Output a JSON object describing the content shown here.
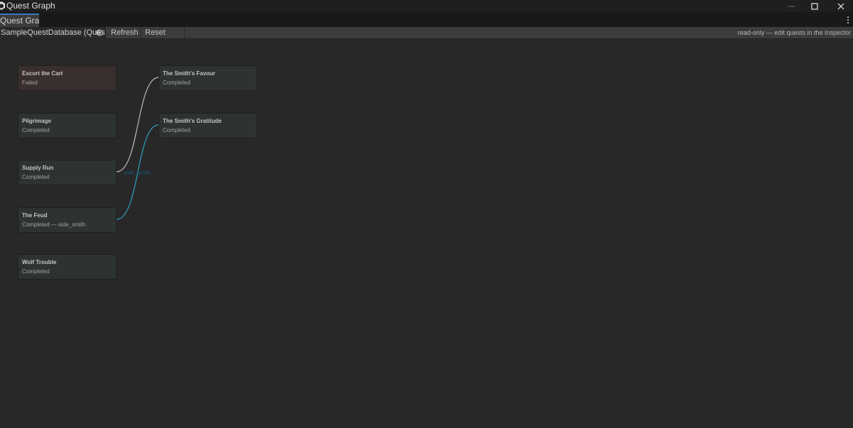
{
  "window": {
    "title": "Quest Graph",
    "app_icon": "unity-editor-icon",
    "controls": [
      "minimize-icon",
      "maximize-icon",
      "close-icon"
    ]
  },
  "tabs": [
    {
      "label": "Quest Graph",
      "active": true
    }
  ],
  "toolbar": {
    "database_field": "SampleQuestDatabase (Ques",
    "refresh_label": "Refresh",
    "reset_label": "Reset view",
    "note": "read-only — edit quests in the Inspector"
  },
  "nodes": {
    "escort": {
      "title": "Escort the Cart",
      "status": "Failed"
    },
    "pilgrimage": {
      "title": "Pilgrimage",
      "status": "Completed"
    },
    "supply": {
      "title": "Supply Run",
      "status": "Completed"
    },
    "feud": {
      "title": "The Feud",
      "status": "Completed — side_smith"
    },
    "wolf": {
      "title": "Wolf Trouble",
      "status": "Completed"
    },
    "favour": {
      "title": "The Smith's Favour",
      "status": "Completed"
    },
    "gratitude": {
      "title": "The Smith's Gratitude",
      "status": "Completed"
    }
  },
  "edges": [
    {
      "from": "Supply Run",
      "to": "The Smith's Favour",
      "color": "#b9b9b9"
    },
    {
      "from": "The Feud",
      "to": "The Smith's Gratitude",
      "color": "#2e9fbf"
    }
  ],
  "edge_label": "side_smith",
  "colors": {
    "accent": "#3a79bb",
    "failed_node": "#3a2f2f",
    "completed_node": "#2d3430"
  }
}
